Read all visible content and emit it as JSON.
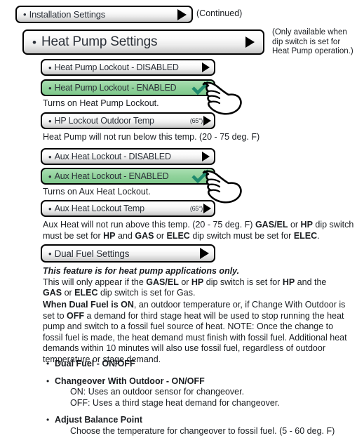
{
  "colors": {
    "selected_green": "#93d39d",
    "check_green": "#1f8a6d",
    "button_face": "#ededed",
    "border": "#000000",
    "text": "#1a1d21"
  },
  "buttons": {
    "installation_settings": {
      "label": "Installation Settings",
      "bullet": "•",
      "arrow_icon": "play-arrow-icon",
      "selected": false
    },
    "heat_pump_settings": {
      "label": "Heat Pump Settings",
      "bullet": "•",
      "arrow_icon": "play-arrow-icon",
      "selected": false
    },
    "hp_lockout_disabled": {
      "label": "Heat Pump Lockout - DISABLED",
      "bullet": "•",
      "arrow_icon": "play-arrow-icon",
      "selected": false
    },
    "hp_lockout_enabled": {
      "label": "Heat Pump Lockout - ENABLED",
      "bullet": "•",
      "check_icon": "check-icon",
      "selected": true
    },
    "hp_lockout_outdoor_temp": {
      "label": "HP Lockout Outdoor Temp",
      "value": "(65°)",
      "bullet": "•",
      "arrow_icon": "play-arrow-icon",
      "selected": false
    },
    "aux_lockout_disabled": {
      "label": "Aux Heat Lockout - DISABLED",
      "bullet": "•",
      "arrow_icon": "play-arrow-icon",
      "selected": false
    },
    "aux_lockout_enabled": {
      "label": "Aux Heat Lockout - ENABLED",
      "bullet": "•",
      "check_icon": "check-icon",
      "selected": true
    },
    "aux_lockout_temp": {
      "label": "Aux Heat Lockout Temp",
      "value": "(65°)",
      "bullet": "•",
      "arrow_icon": "play-arrow-icon",
      "selected": false
    },
    "dual_fuel_settings": {
      "label": "Dual Fuel Settings",
      "bullet": "•",
      "arrow_icon": "play-arrow-icon",
      "selected": false
    }
  },
  "annotations": {
    "continued": "(Continued)",
    "dip_switch_note": "(Only available when dip switch is set for Heat Pump operation.)"
  },
  "captions": {
    "turns_on_hp_lockout": "Turns on Heat Pump Lockout.",
    "hp_below_temp": "Heat Pump will not run below this temp. (20 - 75 deg. F)",
    "turns_on_aux_lockout": "Turns on Aux Heat Lockout."
  },
  "paragraphs": {
    "aux_above": {
      "p1": "Aux Heat will not run above this temp. (20 - 75 deg. F) ",
      "b1": "GAS/EL",
      "p2": " or ",
      "b2": "HP",
      "p3": " dip switch must be set for ",
      "b3": "HP",
      "p4": " and ",
      "b4": "GAS",
      "p5": " or ",
      "b5": "ELEC",
      "p6": " dip switch must be set for ",
      "b6": "ELEC",
      "p7": "."
    },
    "feature": {
      "heading": "This feature is for heat pump applications only.",
      "p1": "This will only appear if the ",
      "b1": "GAS/EL",
      "p2": " or ",
      "b2": "HP",
      "p3": " dip switch is set for ",
      "b3": "HP",
      "p4": " and the ",
      "b4": "GAS",
      "p5": " or ",
      "b5": "ELEC",
      "p6": " dip switch is set for Gas."
    },
    "dual_fuel": {
      "b1": "When Dual Fuel is ON",
      "p1": ", an outdoor temperature or, if Change With Outdoor is set to ",
      "b2": "OFF",
      "p2": " a demand for third stage heat will be used to stop running the heat pump and switch to a fossil fuel source of heat. NOTE: Once the change to fossil fuel is made, the heat demand must finish with fossil fuel.  Additional heat demands within 10 minutes will also use fossil fuel, regardless of outdoor temperature or stage demand."
    }
  },
  "bullet_list": [
    {
      "bullet": "•",
      "title": "Dual Fuel - ON/OFF",
      "lines": []
    },
    {
      "bullet": "•",
      "title": "Changeover With Outdoor - ON/OFF",
      "lines": [
        "ON: Uses an outdoor sensor for changeover.",
        "OFF: Uses a third stage heat demand for changeover."
      ]
    },
    {
      "bullet": "•",
      "title": "Adjust Balance Point",
      "lines": [
        "Choose the temperature for changeover to fossil fuel. (5 - 60 deg. F)"
      ]
    }
  ],
  "cursors": [
    {
      "name": "pointing-hand-cursor",
      "target": "hp_lockout_enabled"
    },
    {
      "name": "pointing-hand-cursor",
      "target": "aux_lockout_enabled"
    }
  ]
}
